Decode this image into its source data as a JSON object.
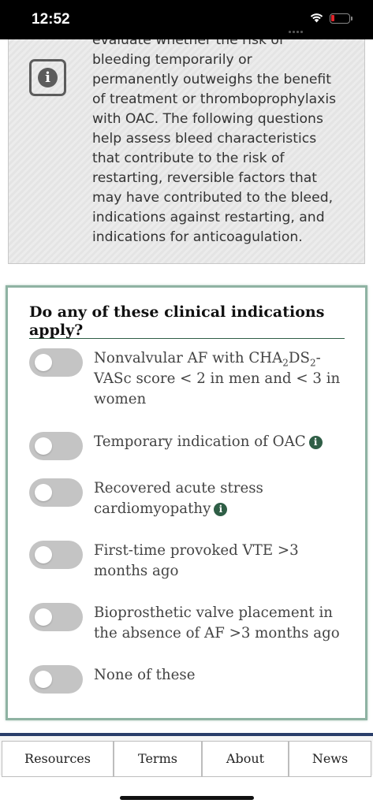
{
  "status_bar": {
    "time": "12:52"
  },
  "info_panel": {
    "lines": [
      "evaluate whether the risk of",
      "bleeding temporarily or",
      "permanently outweighs the benefit",
      "of treatment or thromboprophylaxis",
      "with OAC. The following questions",
      "help assess bleed characteristics",
      "that contribute to the risk of",
      "restarting, reversible factors that",
      "may have contributed to the bleed,",
      "indications against restarting, and",
      "indications for anticoagulation."
    ],
    "icon": "info-icon"
  },
  "question": {
    "title": "Do any of these clinical indications apply?",
    "options": [
      {
        "label_prefix": "Nonvalvular AF with CHA",
        "sub1": "2",
        "label_mid": "DS",
        "sub2": "2",
        "label_suffix": "-VASc score < 2 in men and < 3 in women",
        "on": false
      },
      {
        "label": "Temporary indication of OAC",
        "has_info": true,
        "on": false
      },
      {
        "label": "Recovered acute stress cardiomyopathy",
        "has_info": true,
        "on": false
      },
      {
        "label": "First-time provoked VTE >3 months ago",
        "on": false
      },
      {
        "label": "Bioprosthetic valve placement in the absence of AF >3 months ago",
        "on": false
      },
      {
        "label": "None of these",
        "on": false
      }
    ]
  },
  "nav": {
    "items": [
      "Resources",
      "Terms",
      "About",
      "News"
    ]
  },
  "colors": {
    "accent_green": "#2f5e46",
    "card_border": "#8fb3a3",
    "nav_border": "#2a3e6a",
    "toggle_off": "#c4c4c4"
  }
}
